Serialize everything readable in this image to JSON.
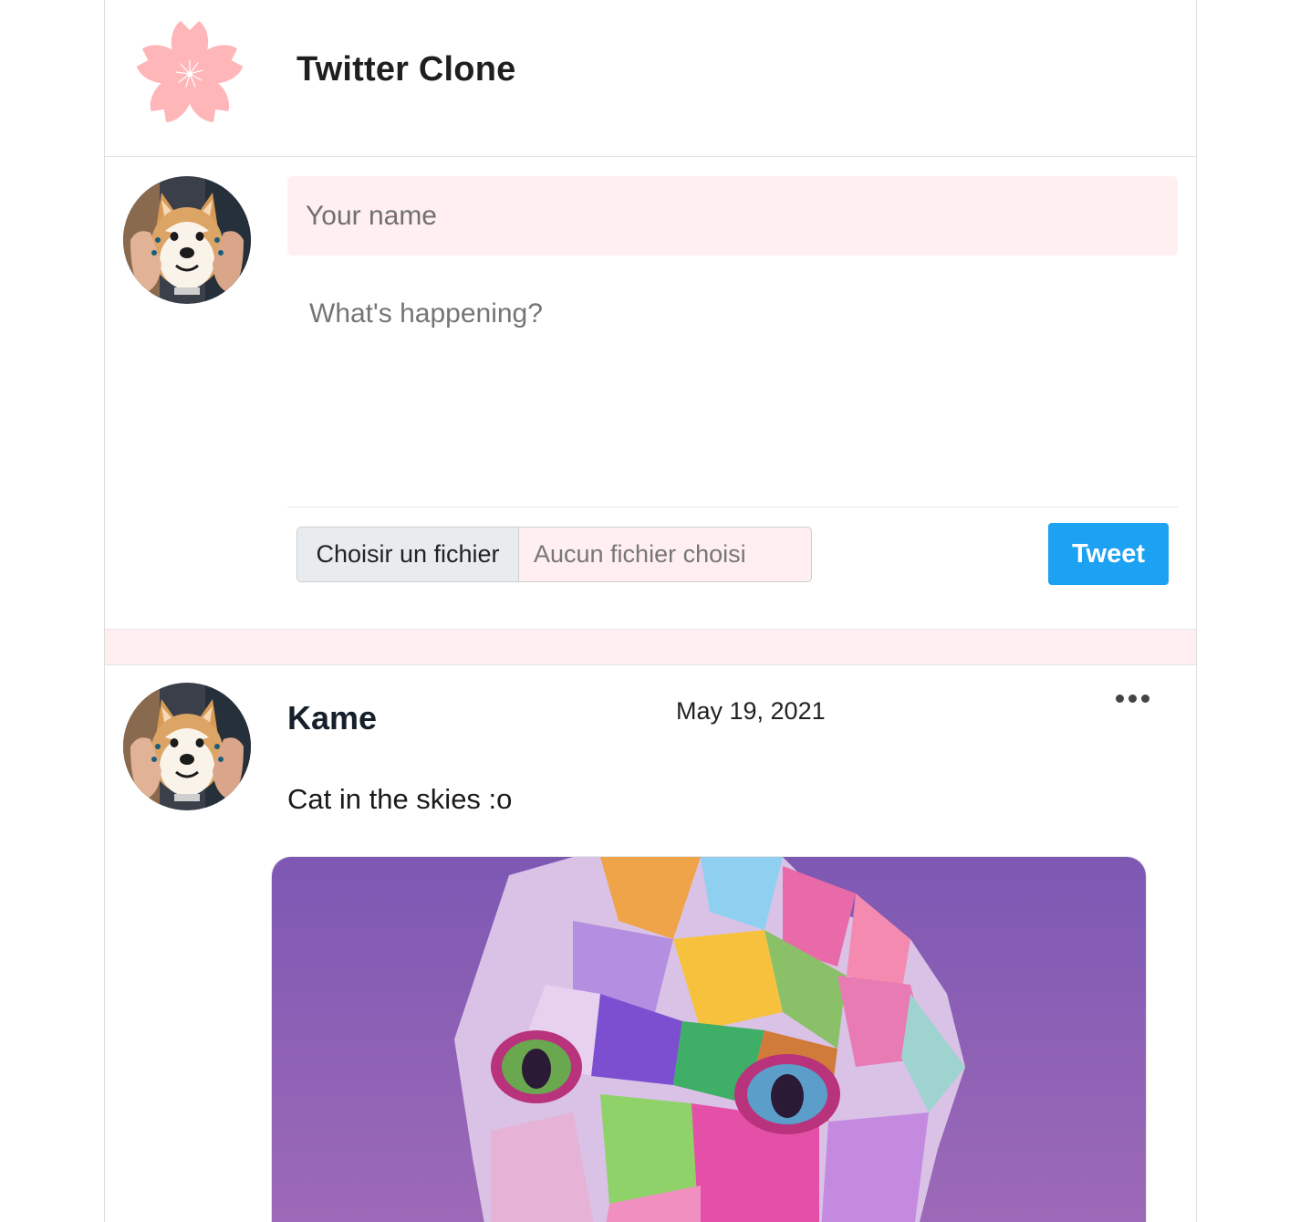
{
  "header": {
    "title": "Twitter Clone",
    "logo_icon": "sakura-flower-icon",
    "logo_color": "#ffb6b9"
  },
  "composer": {
    "name_placeholder": "Your name",
    "name_value": "",
    "text_placeholder": "What's happening?",
    "text_value": "",
    "file_button_label": "Choisir un fichier",
    "file_status": "Aucun fichier choisi",
    "tweet_button_label": "Tweet",
    "accent_color": "#1da1f2",
    "input_background": "#ffeff0"
  },
  "feed": {
    "tweets": [
      {
        "author": "Kame",
        "date": "May 19, 2021",
        "text": "Cat in the skies :o",
        "has_image": true,
        "menu_icon": "more-horizontal-icon"
      }
    ]
  }
}
